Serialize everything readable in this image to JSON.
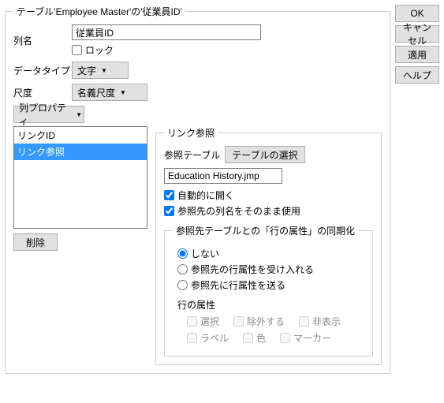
{
  "legend_main": "テーブル'Employee Master'の'従業員ID'",
  "col_name_label": "列名",
  "col_name_value": "従業員ID",
  "lock_label": "ロック",
  "data_type_label": "データタイプ",
  "data_type_value": "文字",
  "scale_label": "尺度",
  "scale_value": "名義尺度",
  "col_prop_label": "列プロパティ",
  "list_items": [
    "リンクID",
    "リンク参照"
  ],
  "list_selected_index": 1,
  "delete_label": "削除",
  "link_ref": {
    "legend": "リンク参照",
    "ref_table_label": "参照テーブル",
    "select_table_label": "テーブルの選択",
    "ref_table_value": "Education History.jmp",
    "auto_open_label": "自動的に開く",
    "use_ref_col_name_label": "参照先の列名をそのまま使用",
    "sync_legend": "参照先テーブルとの「行の属性」の同期化",
    "radios": {
      "none": "しない",
      "accept": "参照先の行属性を受け入れる",
      "send": "参照先に行属性を送る"
    },
    "row_attr_label": "行の属性",
    "attrs": {
      "select": "選択",
      "exclude": "除外する",
      "hide": "非表示",
      "label": "ラベル",
      "color": "色",
      "marker": "マーカー"
    }
  },
  "buttons": {
    "ok": "OK",
    "cancel": "キャンセル",
    "apply": "適用",
    "help": "ヘルプ"
  }
}
